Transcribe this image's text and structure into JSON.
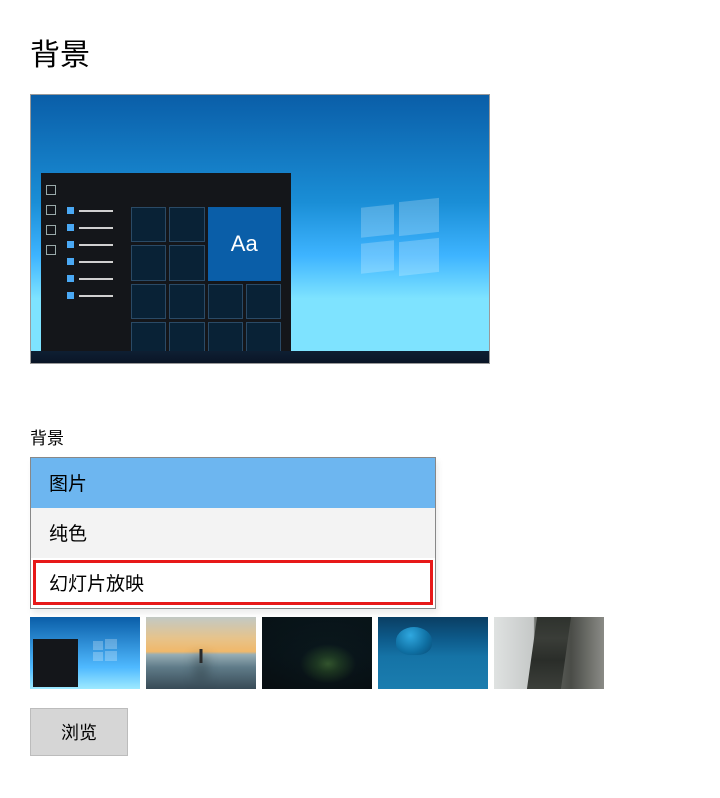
{
  "title": "背景",
  "preview": {
    "sample_text": "Aa"
  },
  "background_section": {
    "label": "背景",
    "dropdown": {
      "selected": "图片",
      "highlighted": "幻灯片放映",
      "options": [
        "图片",
        "纯色",
        "幻灯片放映"
      ]
    }
  },
  "thumbnails": {
    "items": [
      {
        "name": "windows-default"
      },
      {
        "name": "beach-sunset"
      },
      {
        "name": "night-camp"
      },
      {
        "name": "underwater"
      },
      {
        "name": "cliff"
      }
    ],
    "active_index": 0
  },
  "browse_button_label": "浏览"
}
